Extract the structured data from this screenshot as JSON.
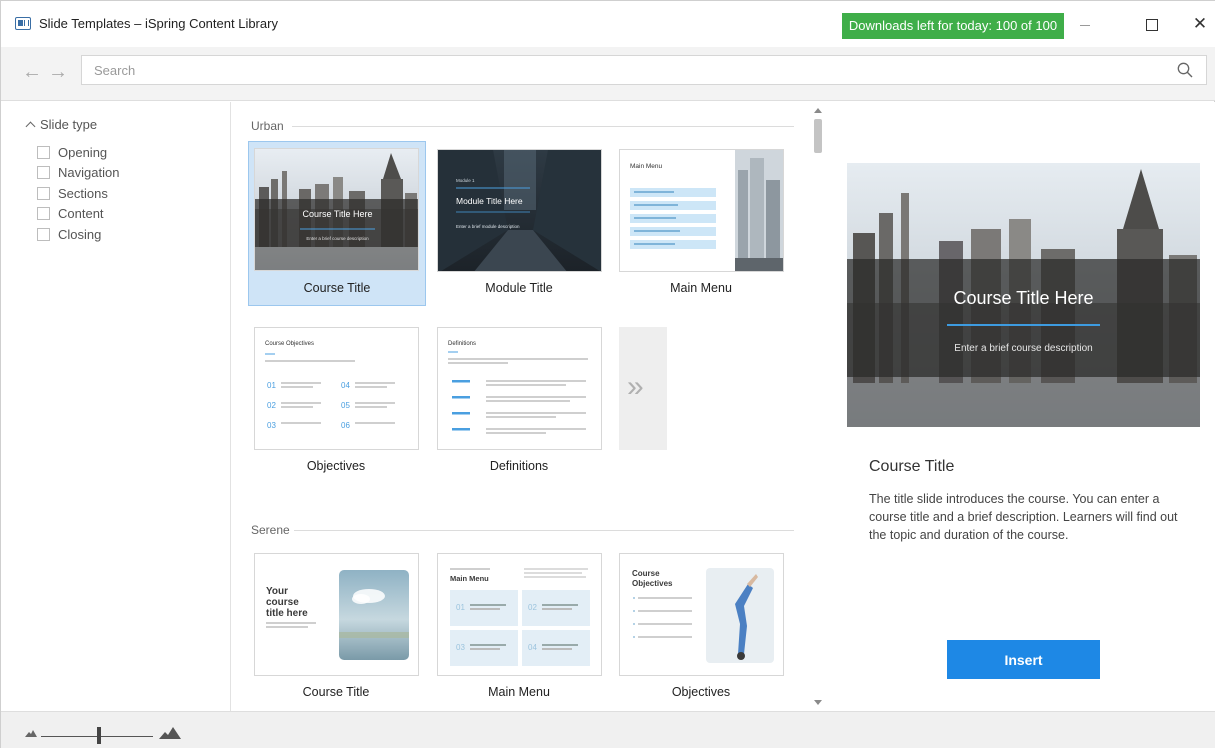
{
  "window": {
    "title": "Slide Templates – iSpring Content Library",
    "downloads_badge": "Downloads left for today: 100 of 100",
    "close_glyph": "✕",
    "app_icon": "slide-template-icon"
  },
  "nav": {
    "back_glyph": "←",
    "forward_glyph": "→",
    "search_placeholder": "Search",
    "search_value": ""
  },
  "sidebar": {
    "filter_title": "Slide type",
    "items": [
      {
        "label": "Opening",
        "checked": false
      },
      {
        "label": "Navigation",
        "checked": false
      },
      {
        "label": "Sections",
        "checked": false
      },
      {
        "label": "Content",
        "checked": false
      },
      {
        "label": "Closing",
        "checked": false
      }
    ]
  },
  "gallery": {
    "more_glyph": "»",
    "sections": [
      {
        "name": "Urban",
        "cards": [
          {
            "label": "Course Title",
            "selected": true,
            "thumb_title": "Course Title Here",
            "thumb_subtitle": "Enter a brief course description"
          },
          {
            "label": "Module Title",
            "selected": false,
            "thumb_kicker": "Module 1",
            "thumb_title": "Module Title Here",
            "thumb_subtitle": "Enter a brief module description"
          },
          {
            "label": "Main Menu",
            "selected": false,
            "thumb_title": "Main Menu"
          },
          {
            "label": "Objectives",
            "selected": false,
            "thumb_title": "Course Objectives"
          },
          {
            "label": "Definitions",
            "selected": false,
            "thumb_title": "Definitions"
          }
        ]
      },
      {
        "name": "Serene",
        "cards": [
          {
            "label": "Course Title",
            "selected": false,
            "thumb_title": "Your course title here"
          },
          {
            "label": "Main Menu",
            "selected": false,
            "thumb_title": "Main Menu"
          },
          {
            "label": "Objectives",
            "selected": false,
            "thumb_title": "Course Objectives"
          }
        ]
      }
    ]
  },
  "preview": {
    "slide_title": "Course Title Here",
    "slide_subtitle": "Enter a brief course description",
    "title": "Course Title",
    "description": "The title slide introduces the course. You can enter a course title and a brief description. Learners will find out the topic and duration of the course.",
    "insert_label": "Insert"
  },
  "colors": {
    "accent": "#1e88e5",
    "downloads_badge": "#3fae49",
    "selection": "#cfe4f7"
  }
}
